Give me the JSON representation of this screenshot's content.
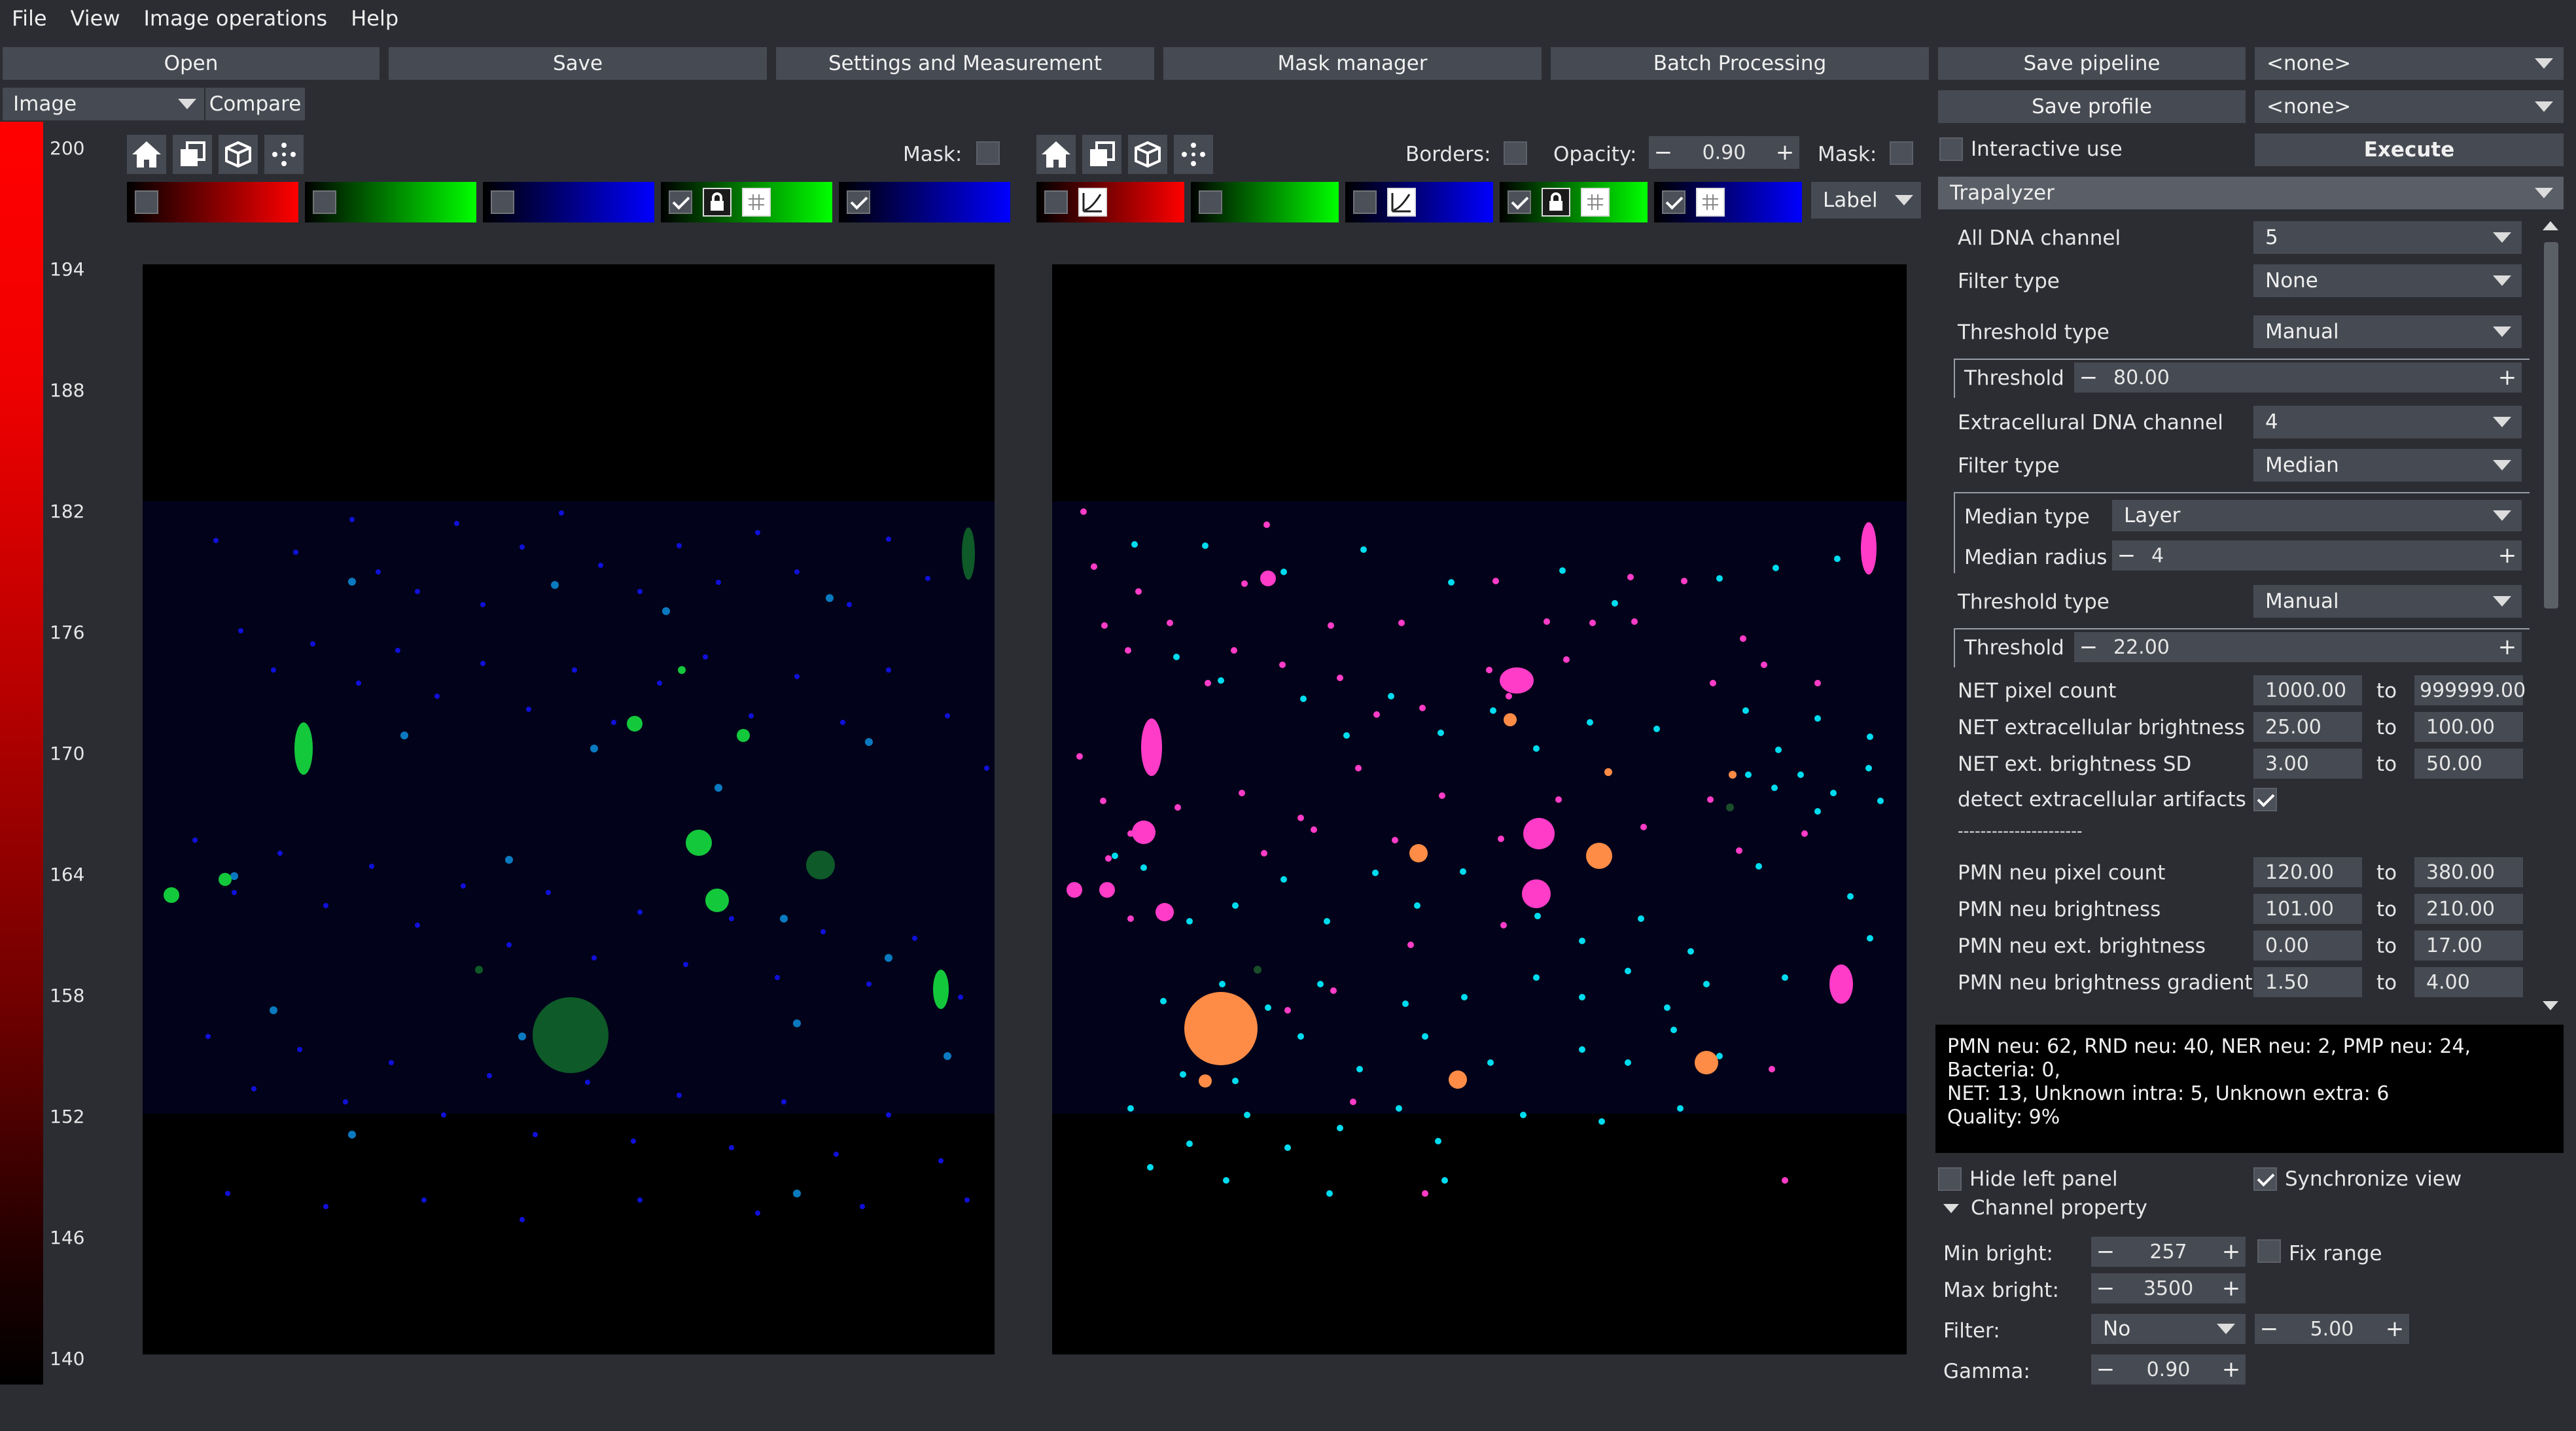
{
  "menu": [
    "File",
    "View",
    "Image operations",
    "Help"
  ],
  "toolbar": {
    "open": "Open",
    "save": "Save",
    "settings": "Settings and Measurement",
    "mask_manager": "Mask manager",
    "batch": "Batch Processing",
    "save_pipeline": "Save pipeline",
    "save_profile": "Save profile",
    "pipeline_select": "<none>",
    "profile_select": "<none>",
    "execute": "Execute",
    "interactive_use": "Interactive use"
  },
  "left_panel": {
    "image_select": "Image",
    "compare_button": "Compare",
    "colorbar_ticks": [
      "200",
      "194",
      "188",
      "182",
      "176",
      "170",
      "164",
      "158",
      "152",
      "146",
      "140"
    ],
    "mask_label": "Mask:"
  },
  "right_view": {
    "borders_label": "Borders:",
    "opacity_label": "Opacity:",
    "opacity_value": "0.90",
    "mask_label": "Mask:",
    "label_select": "Label"
  },
  "algorithm": {
    "name": "Trapalyzer",
    "params": {
      "all_dna_channel": {
        "label": "All DNA channel",
        "value": "5"
      },
      "filter_type_1": {
        "label": "Filter type",
        "value": "None"
      },
      "threshold_type_1": {
        "label": "Threshold type",
        "value": "Manual"
      },
      "threshold_1": {
        "label": "Threshold",
        "value": "80.00"
      },
      "extracellular_dna_channel": {
        "label": "Extracellural DNA channel",
        "value": "4"
      },
      "filter_type_2": {
        "label": "Filter type",
        "value": "Median"
      },
      "median_type": {
        "label": "Median type",
        "value": "Layer"
      },
      "median_radius": {
        "label": "Median radius",
        "value": "4"
      },
      "threshold_type_2": {
        "label": "Threshold type",
        "value": "Manual"
      },
      "threshold_2": {
        "label": "Threshold",
        "value": "22.00"
      }
    },
    "ranges": [
      {
        "label": "NET pixel count",
        "from": "1000.00",
        "to": "999999.00"
      },
      {
        "label": "NET extracellular brightness",
        "from": "25.00",
        "to": "100.00"
      },
      {
        "label": "NET ext. brightness SD",
        "from": "3.00",
        "to": "50.00"
      }
    ],
    "detect_artifacts": "detect extracellular artifacts",
    "separator": "----------------------",
    "ranges_pmn": [
      {
        "label": "PMN neu pixel count",
        "from": "120.00",
        "to": "380.00"
      },
      {
        "label": "PMN neu brightness",
        "from": "101.00",
        "to": "210.00"
      },
      {
        "label": "PMN neu ext. brightness",
        "from": "0.00",
        "to": "17.00"
      },
      {
        "label": "PMN neu brightness gradient",
        "from": "1.50",
        "to": "4.00"
      }
    ],
    "to_word": "to"
  },
  "stats": {
    "line1": "PMN neu: 62, RND neu: 40, NER neu: 2, PMP neu: 24, Bacteria: 0,",
    "line2": "NET: 13, Unknown intra: 5, Unknown extra: 6",
    "line3": "Quality: 9%"
  },
  "bottom": {
    "hide_left_panel": "Hide left panel",
    "synchronize_view": "Synchronize view",
    "channel_property": "Channel property",
    "min_bright_label": "Min bright:",
    "min_bright": "257",
    "fix_range": "Fix range",
    "max_bright_label": "Max bright:",
    "max_bright": "3500",
    "filter_label": "Filter:",
    "filter_value": "No",
    "filter_radius": "5.00",
    "gamma_label": "Gamma:",
    "gamma": "0.90"
  },
  "colors": {
    "background": "#2b2d33",
    "button": "#464a52",
    "red": "#ff0000",
    "green": "#00ff00",
    "blue": "#0000ff",
    "magenta": "#ff40c0",
    "cyan": "#00e8f0",
    "orange": "#ff8c40"
  }
}
